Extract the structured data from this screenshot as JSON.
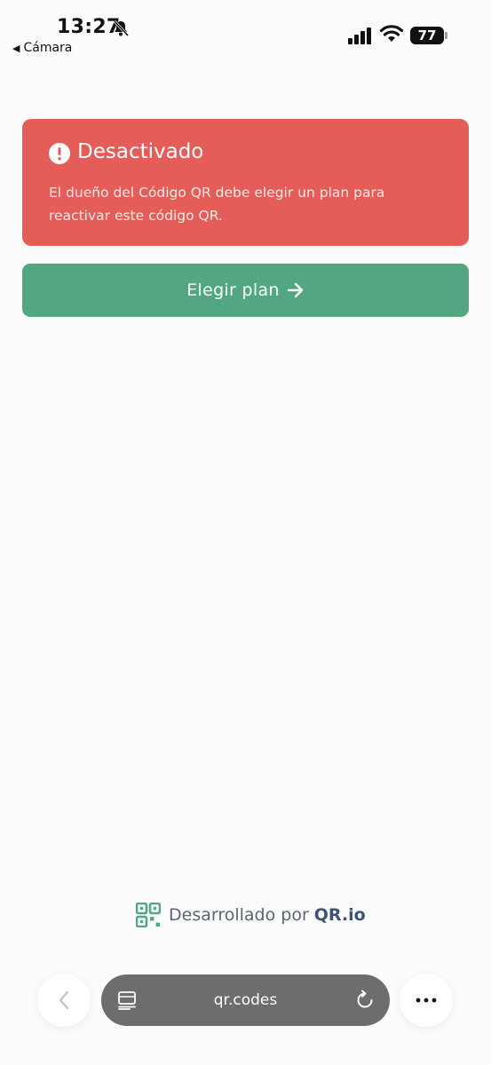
{
  "status_bar": {
    "time": "13:27",
    "back_app_label": "Cámara",
    "battery_level": "77",
    "icons": [
      "bell-slash-icon",
      "signal-icon",
      "wifi-icon",
      "battery-icon"
    ]
  },
  "alert": {
    "title": "Desactivado",
    "message": "El dueño del Código QR debe elegir un plan para reactivar este código QR.",
    "color": "#e55d58",
    "icon": "exclamation-circle-icon"
  },
  "plan_button": {
    "label": "Elegir plan",
    "color": "#52a780",
    "icon": "arrow-right-icon"
  },
  "footer": {
    "powered_by": "Desarrollado por",
    "brand": "QR.io",
    "icon": "qr-logo-icon",
    "brand_color": "#52a780"
  },
  "browser": {
    "url": "qr.codes",
    "icons": [
      "chevron-left-icon",
      "reader-icon",
      "reload-icon",
      "more-icon"
    ]
  }
}
